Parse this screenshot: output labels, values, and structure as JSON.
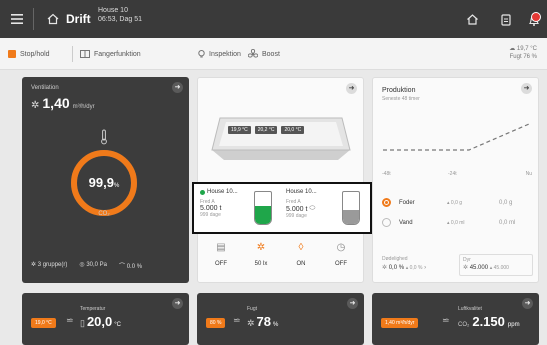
{
  "header": {
    "title": "Drift",
    "house_name": "House 10",
    "time_day": "06:53, Dag 51"
  },
  "toolbar": {
    "stop_label": "Stop/hold",
    "catch_label": "Fangerfunktion",
    "inspection_label": "Inspektion",
    "boost_label": "Boost",
    "outdoor_temp": "19,7 °C",
    "outdoor_humidity": "Fugt 76 %"
  },
  "ventilation": {
    "title": "Ventilation",
    "value": "1,40",
    "unit": "m³/h/dyr",
    "gauge_value": "99,9",
    "gauge_unit": "%",
    "gauge_fraction": 0.999,
    "co2_label": "CO₂",
    "group_label": "3 gruppe(r)",
    "pressure_label": "30,0 Pa",
    "percent_label": "0.0 %"
  },
  "house_model": {
    "temps": [
      "19,9 °C",
      "20,2 °C",
      "20,0 °C"
    ]
  },
  "silos": [
    {
      "name": "House 10...",
      "line": "Fred A",
      "amount": "5.000 t",
      "days": "999 dage",
      "fill_fraction": 0.55,
      "fill_color": "#1fa64a"
    },
    {
      "name": "House 10...",
      "line": "Fred A",
      "amount": "5.000 t",
      "days": "999 dage",
      "fill_fraction": 0.45,
      "fill_color": "#9a9a9a"
    }
  ],
  "states": [
    {
      "icon": "calendar-icon",
      "label": "OFF"
    },
    {
      "icon": "light-icon",
      "label": "50 lx"
    },
    {
      "icon": "water-drop-icon",
      "label": "ON"
    },
    {
      "icon": "timer-icon",
      "label": "OFF"
    }
  ],
  "production": {
    "title": "Produktion",
    "subtitle": "Seneste 48 timer",
    "x_ticks": [
      "-48t",
      "-24t",
      "Nu"
    ],
    "feed_label": "Foder",
    "feed_rate": "0,0 g",
    "feed_total": "0,0 g",
    "water_label": "Vand",
    "water_rate": "0,0 ml",
    "water_total": "0,0 ml",
    "mortality_label": "Dødelighed",
    "mortality_value": "0,0 %",
    "mortality_sub": "0,0 %",
    "animals_label": "Dyr",
    "animals_value": "45.000",
    "animals_sub": "45.000"
  },
  "temperature": {
    "title": "Temperatur",
    "setpoint": "19,0 °C",
    "value": "20,0",
    "unit": "°C"
  },
  "humidity": {
    "title": "Fugt",
    "setpoint": "80 %",
    "value": "78",
    "unit": "%"
  },
  "air_quality": {
    "title": "Luftkvalitet",
    "setpoint": "1,40 m³/h/dyr",
    "co2_label": "CO₂",
    "value": "2.150",
    "unit": "ppm"
  }
}
